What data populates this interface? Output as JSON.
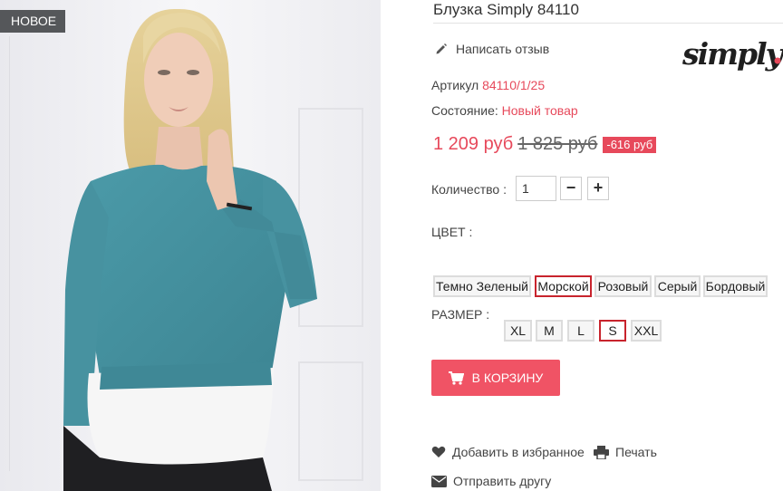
{
  "product": {
    "title": "Блузка Simply 84110",
    "badge": "НОВОЕ",
    "review_link": "Написать отзыв",
    "brand_logo_text": "simply",
    "sku_label": "Артикул",
    "sku_value": "84110/1/25",
    "condition_label": "Состояние:",
    "condition_value": "Новый товар",
    "price_current": "1 209 руб",
    "price_old": "1 825 руб",
    "discount": "-616 руб",
    "quantity_label": "Количество :",
    "quantity_value": "1",
    "qty_minus": "−",
    "qty_plus": "+"
  },
  "color": {
    "label": "ЦВЕТ :",
    "options": [
      "Темно Зеленый",
      "Морской",
      "Розовый",
      "Серый",
      "Бордовый"
    ],
    "selected": "Морской"
  },
  "size": {
    "label": "РАЗМЕР :",
    "options": [
      "XL",
      "M",
      "L",
      "S",
      "XXL"
    ],
    "selected": "S"
  },
  "actions": {
    "add_to_cart": "В КОРЗИНУ",
    "wishlist": "Добавить в избранное",
    "print": "Печать",
    "send_to_friend": "Отправить другу"
  },
  "colors": {
    "accent": "#e7495b",
    "cart_button": "#f05365",
    "selected_border": "#c8242d",
    "badge_bg": "#55575a"
  }
}
